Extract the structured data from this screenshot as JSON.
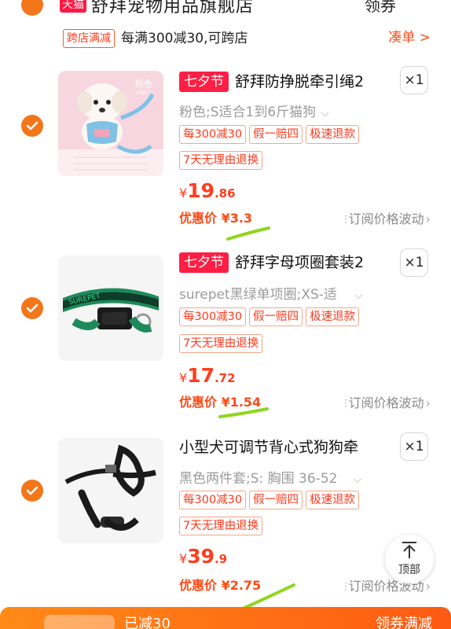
{
  "store": {
    "tmall_tag": "天猫",
    "name": "舒拜宠物用品旗舰店",
    "coupon": "领券"
  },
  "promo": {
    "tag": "跨店满减",
    "text": "每满300减30,可跨店",
    "link": "凑单 >"
  },
  "items": [
    {
      "festival": "七夕节",
      "title": "舒拜防挣脱牵引绳2",
      "qty": "×1",
      "spec": "粉色;S适合1到6斤猫狗",
      "tags": [
        "每300减30",
        "假一赔四",
        "极速退款"
      ],
      "tag2": "7天无理由退换",
      "price_currency": "¥",
      "price_int": "19",
      "price_dec": ".86",
      "deal": "优惠价 ¥3.3",
      "subscribe": "订阅价格波动",
      "image_label": "粉色",
      "image_sub": "PINK"
    },
    {
      "festival": "七夕节",
      "title": "舒拜字母项圈套装2",
      "qty": "×1",
      "spec": "surepet黑绿单项圈;XS-适",
      "tags": [
        "每300减30",
        "假一赔四",
        "极速退款"
      ],
      "tag2": "7天无理由退换",
      "price_currency": "¥",
      "price_int": "17",
      "price_dec": ".72",
      "deal": "优惠价 ¥1.54",
      "subscribe": "订阅价格波动",
      "image_label": "SUREPET"
    },
    {
      "festival": "",
      "title": "小型犬可调节背心式狗狗牵",
      "qty": "×1",
      "spec": "黑色两件套;S: 胸围 36-52",
      "tags": [
        "每300减30",
        "假一赔四",
        "极速退款"
      ],
      "tag2": "7天无理由退换",
      "price_currency": "¥",
      "price_int": "39",
      "price_dec": ".9",
      "deal": "优惠价 ¥2.75",
      "subscribe": "订阅价格波动"
    }
  ],
  "to_top": "顶部",
  "bottom": {
    "text": "已减30",
    "right": "领券满减"
  },
  "colors": {
    "accent": "#ff3d1f",
    "check": "#f3761b",
    "festival": "#ff1f44",
    "highlight_mark": "#8fd61e"
  }
}
